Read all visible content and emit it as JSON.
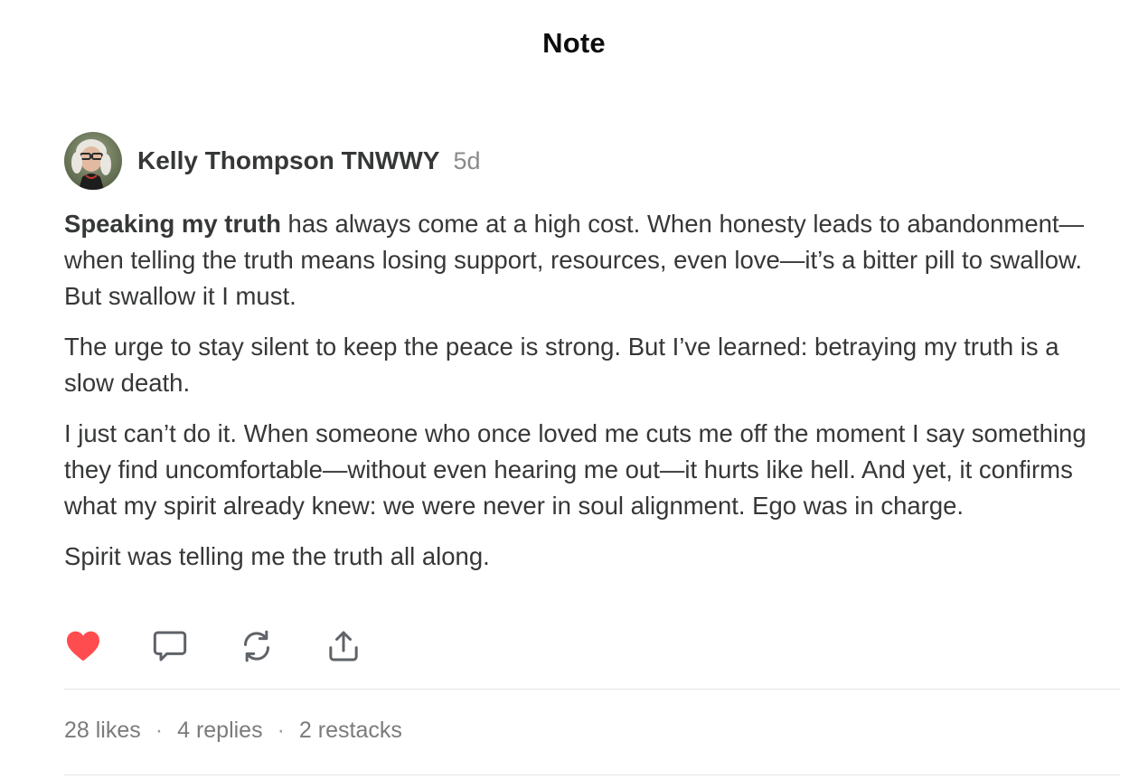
{
  "header": {
    "title": "Note"
  },
  "post": {
    "author_name": "Kelly Thompson TNWWY",
    "timestamp": "5d",
    "paragraphs": [
      {
        "bold": "Speaking my truth",
        "text": " has always come at a high cost. When honesty leads to abandonment—when telling the truth means losing support, resources, even love—it’s a bitter pill to swallow. But swallow it I must."
      },
      {
        "bold": "",
        "text": "The urge to stay silent to keep the peace is strong. But I’ve learned: betraying my truth is a slow death."
      },
      {
        "bold": "",
        "text": "I just can’t do it. When someone who once loved me cuts me off the moment I say something they find uncomfortable—without even hearing me out—it hurts like hell. And yet, it confirms what my spirit already knew: we were never in soul alignment. Ego was in charge."
      },
      {
        "bold": "",
        "text": "Spirit was telling me the truth all along."
      }
    ],
    "actions": {
      "like_icon": "heart-filled-icon",
      "comment_icon": "speech-bubble-icon",
      "restack_icon": "restack-arrows-icon",
      "share_icon": "share-upload-icon",
      "like_color": "#ff4d4f",
      "icon_color": "#5f6368"
    },
    "stats": {
      "likes": "28 likes",
      "replies": "4 replies",
      "restacks": "2 restacks",
      "separator": "·"
    }
  }
}
